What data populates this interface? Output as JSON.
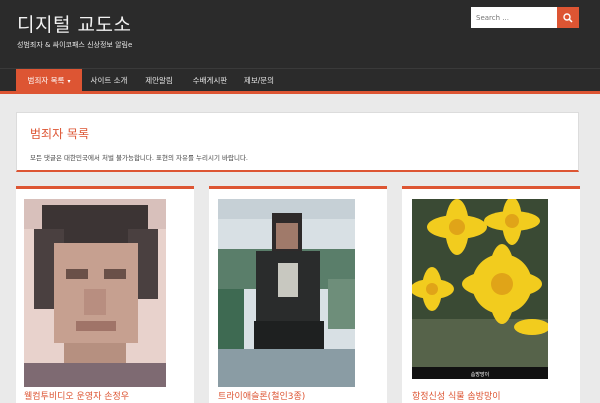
{
  "site": {
    "title": "디지털 교도소",
    "tagline": "성범죄자 & 싸이코패스 신상정보 알림e"
  },
  "search": {
    "placeholder": "Search ..."
  },
  "nav": {
    "items": [
      {
        "label": "범죄자 목록",
        "active": true,
        "has_dropdown": true
      },
      {
        "label": "사이트 소개",
        "active": false
      },
      {
        "label": "제안알림",
        "active": false
      },
      {
        "label": "수배게시판",
        "active": false
      },
      {
        "label": "제보/문의",
        "active": false
      }
    ]
  },
  "intro": {
    "title": "범죄자 목록",
    "text": "모든 댓글은 대한민국에서 처벌 불가능합니다. 표현의 자유를 누리시기 바랍니다."
  },
  "cards": [
    {
      "title": "웰컴투비디오 운영자 손정우",
      "image": "pixelated-face-photo"
    },
    {
      "title": "트라이애슬론(철인3종)",
      "image": "pixelated-person-photo"
    },
    {
      "title": "항정신성 식물 솜방망이",
      "image": "yellow-flower-photo",
      "image_caption": "솜방망이"
    }
  ],
  "colors": {
    "accent": "#dd5533",
    "header_bg": "#2b2b2b",
    "page_bg": "#eaeaea"
  }
}
